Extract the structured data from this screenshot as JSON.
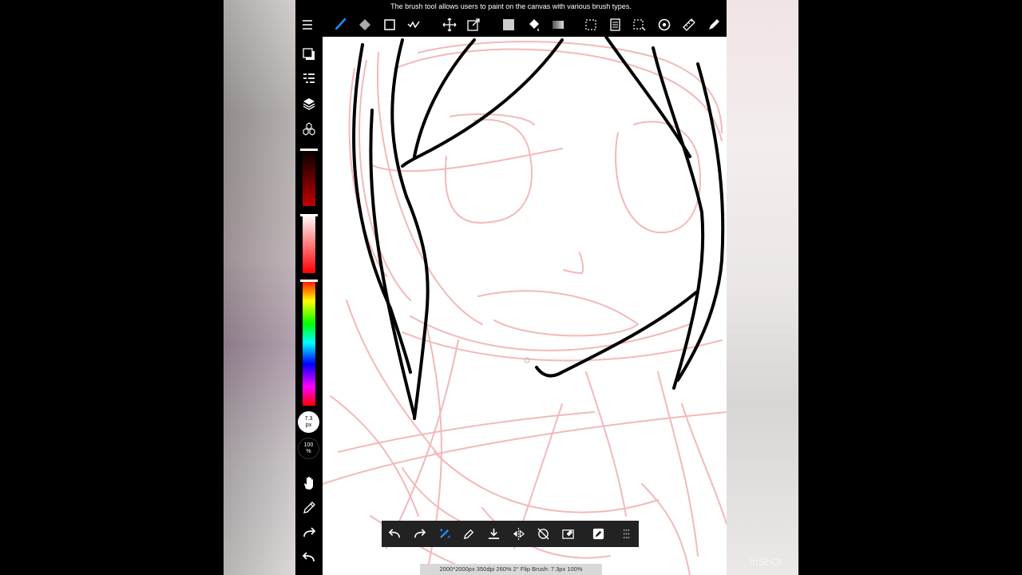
{
  "tooltip": "The brush tool allows users to paint on the canvas with various brush types.",
  "toolbar": {
    "items": [
      "menu-icon",
      "brush-icon",
      "eraser-icon",
      "rectangle-icon",
      "lasso-fill-icon",
      "move-icon",
      "transform-icon",
      "fill-color-icon",
      "bucket-icon",
      "gradient-icon",
      "select-icon",
      "paste-icon",
      "select-dashed-icon",
      "rotate-view-icon",
      "ruler-icon",
      "pen-icon"
    ]
  },
  "sidebar": {
    "brush_size": "7.3",
    "brush_size_unit": "px",
    "opacity": "100",
    "opacity_unit": "%"
  },
  "status_text": "2000*2000px 350dpi 260% 2° Flip Brush: 7.3px 100%",
  "watermark": "InShOt",
  "colors": {
    "sketch": "#f2b9b9",
    "lineart": "#000000",
    "accent": "#1e90ff"
  }
}
